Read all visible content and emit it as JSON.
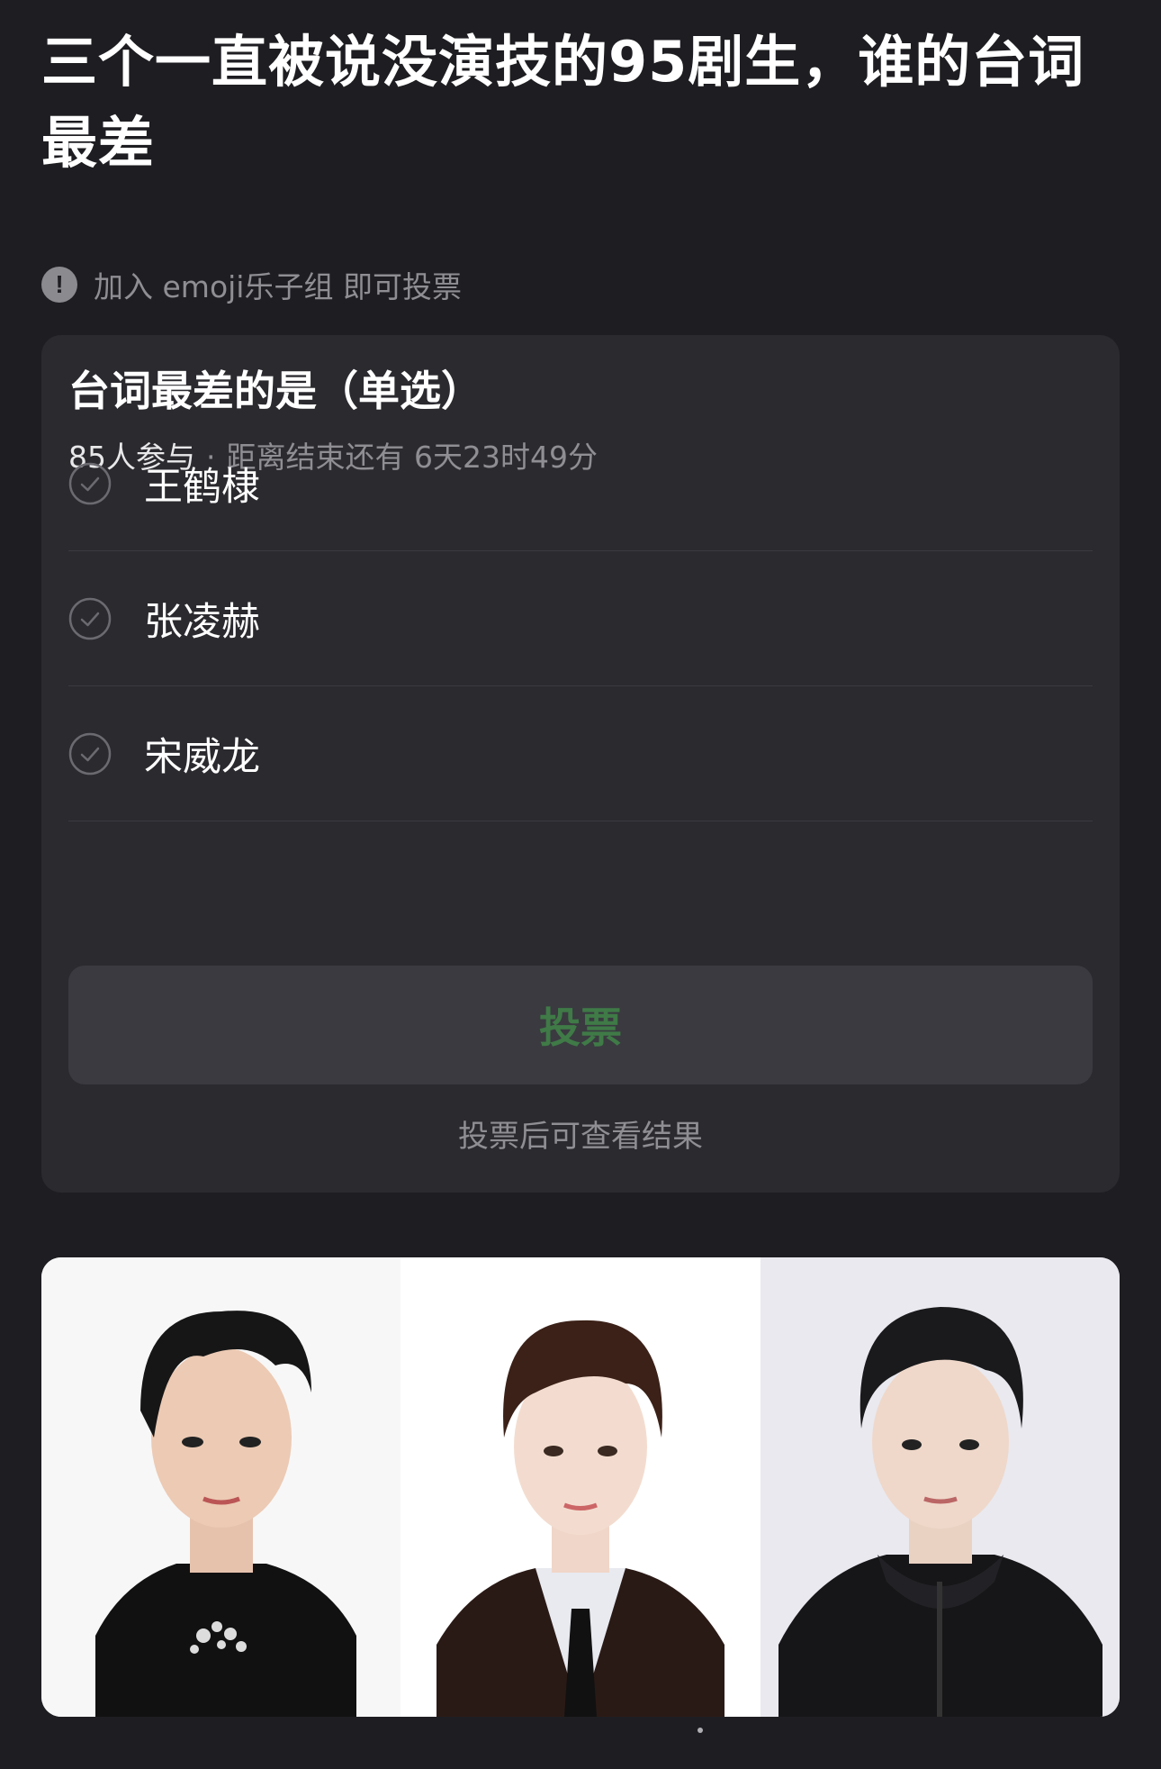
{
  "post": {
    "title": "三个一直被说没演技的95剧生，谁的台词最差"
  },
  "notice": {
    "icon": "exclamation-icon",
    "text": "加入 emoji乐子组 即可投票"
  },
  "poll": {
    "question": "台词最差的是（单选）",
    "participants": "85人参与",
    "separator": "·",
    "deadline": "距离结束还有 6天23时49分",
    "options": [
      {
        "label": "王鹤棣"
      },
      {
        "label": "张凌赫"
      },
      {
        "label": "宋威龙"
      }
    ],
    "vote_button": "投票",
    "hint": "投票后可查看结果",
    "colors": {
      "card_bg": "#2a2a2f",
      "button_bg": "#3a3a40",
      "button_text": "#3f7a47"
    }
  },
  "photos": {
    "count": 3
  }
}
